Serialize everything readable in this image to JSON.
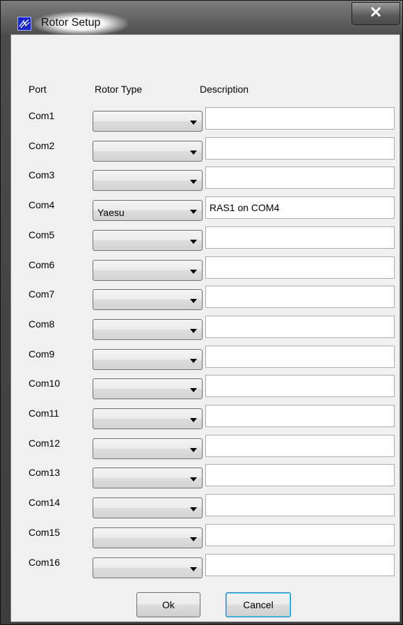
{
  "window": {
    "title": "Rotor Setup",
    "icon": "app-icon",
    "close_icon": "close-icon"
  },
  "headers": {
    "port": "Port",
    "rotor_type": "Rotor Type",
    "description": "Description"
  },
  "rows": [
    {
      "port": "Com1",
      "rotor_type": "",
      "description": ""
    },
    {
      "port": "Com2",
      "rotor_type": "",
      "description": ""
    },
    {
      "port": "Com3",
      "rotor_type": "",
      "description": ""
    },
    {
      "port": "Com4",
      "rotor_type": "Yaesu",
      "description": "RAS1 on COM4"
    },
    {
      "port": "Com5",
      "rotor_type": "",
      "description": ""
    },
    {
      "port": "Com6",
      "rotor_type": "",
      "description": ""
    },
    {
      "port": "Com7",
      "rotor_type": "",
      "description": ""
    },
    {
      "port": "Com8",
      "rotor_type": "",
      "description": ""
    },
    {
      "port": "Com9",
      "rotor_type": "",
      "description": ""
    },
    {
      "port": "Com10",
      "rotor_type": "",
      "description": ""
    },
    {
      "port": "Com11",
      "rotor_type": "",
      "description": ""
    },
    {
      "port": "Com12",
      "rotor_type": "",
      "description": ""
    },
    {
      "port": "Com13",
      "rotor_type": "",
      "description": ""
    },
    {
      "port": "Com14",
      "rotor_type": "",
      "description": ""
    },
    {
      "port": "Com15",
      "rotor_type": "",
      "description": ""
    },
    {
      "port": "Com16",
      "rotor_type": "",
      "description": ""
    }
  ],
  "buttons": {
    "ok": "Ok",
    "cancel": "Cancel"
  }
}
